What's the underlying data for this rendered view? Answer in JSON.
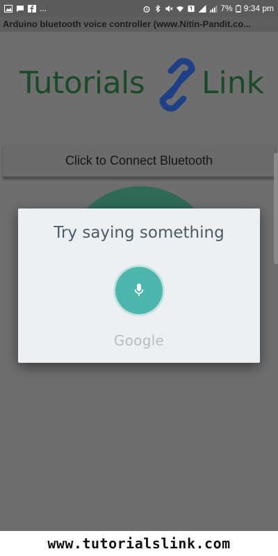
{
  "status_bar": {
    "left_ellipsis": "...",
    "battery": "7%",
    "time": "9:34 pm"
  },
  "app": {
    "window_title": "Arduino bluetooth voice controller (www.Nitin-Pandit.co...",
    "logo": {
      "left": "Tutorials",
      "right": "Link"
    },
    "connect_button_label": "Click to Connect Bluetooth"
  },
  "dialog": {
    "prompt": "Try saying something",
    "mic_icon": "microphone-icon",
    "brand": "Google"
  },
  "footer": {
    "url": "www.tutorialslink.com"
  },
  "colors": {
    "dim_background": "#6e6e6e",
    "dialog_bg": "#ecf0f2",
    "mic_accent": "#4db6ac",
    "logo_green": "#1a4a2a",
    "logo_blue": "#1f3f86",
    "circle_green": "#2f6a57"
  }
}
